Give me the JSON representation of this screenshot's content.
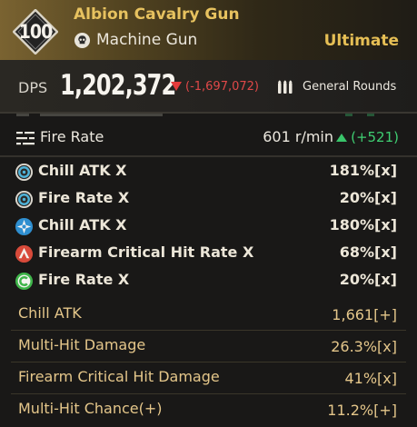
{
  "header": {
    "level": "100",
    "weapon_name": "Albion Cavalry Gun",
    "weapon_type": "Machine Gun",
    "rarity": "Ultimate",
    "gradient_color": "#7a6331",
    "name_color": "#e7c25f"
  },
  "dps": {
    "label": "DPS",
    "value": "1,202,372",
    "delta": "(-1,697,072)",
    "delta_color": "#e04848",
    "ammo_type": "General Rounds"
  },
  "fire_rate": {
    "label": "Fire Rate",
    "value": "601 r/min",
    "delta": "(+521)",
    "delta_color": "#3fce72"
  },
  "substats": [
    {
      "icon": "ring-blue-icon",
      "label": "Chill ATK X",
      "value": "181%[x]",
      "color": "#4fb3d9"
    },
    {
      "icon": "ring-blue-icon",
      "label": "Fire Rate X",
      "value": "20%[x]",
      "color": "#4fb3d9"
    },
    {
      "icon": "diamond-blue-icon",
      "label": "Chill ATK X",
      "value": "180%[x]",
      "color": "#2f8fd0"
    },
    {
      "icon": "red-chevron-icon",
      "label": "Firearm Critical Hit Rate X",
      "value": "68%[x]",
      "color": "#d84a3a"
    },
    {
      "icon": "green-c-icon",
      "label": "Fire Rate X",
      "value": "20%[x]",
      "color": "#3fb54a"
    }
  ],
  "stats": [
    {
      "label": "Chill ATK",
      "value": "1,661[+]"
    },
    {
      "label": "Multi-Hit Damage",
      "value": "26.3%[x]"
    },
    {
      "label": "Firearm Critical Hit Damage",
      "value": "41%[x]"
    },
    {
      "label": "Multi-Hit Chance(+)",
      "value": "11.2%[+]"
    }
  ]
}
